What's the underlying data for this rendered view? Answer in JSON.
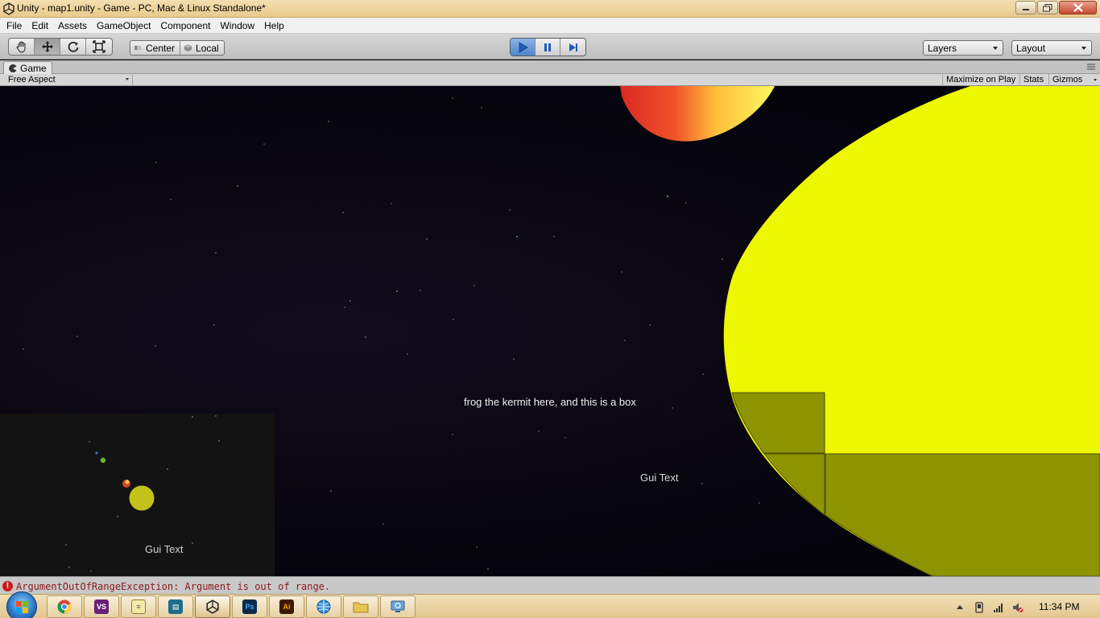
{
  "window": {
    "title": "Unity - map1.unity - Game - PC, Mac & Linux Standalone*"
  },
  "menu": [
    "File",
    "Edit",
    "Assets",
    "GameObject",
    "Component",
    "Window",
    "Help"
  ],
  "toolbar": {
    "pivot_center": "Center",
    "pivot_local": "Local",
    "layers": "Layers",
    "layout": "Layout"
  },
  "game": {
    "tab_label": "Game",
    "aspect": "Free Aspect",
    "maximize_on_play": "Maximize on Play",
    "stats": "Stats",
    "gizmos": "Gizmos",
    "gui_text_center": "frog the kermit here, and this is a box",
    "gui_text_right": "Gui Text",
    "gui_text_minimap": "Gui Text"
  },
  "status": {
    "message": "ArgumentOutOfRangeException: Argument is out of range."
  },
  "taskbar": {
    "apps": [
      "chrome",
      "visual-studio",
      "notepad",
      "sql-tool",
      "unity",
      "photoshop",
      "illustrator",
      "network-tool",
      "file-explorer",
      "remote-desktop"
    ],
    "clock": "11:34 PM"
  },
  "colors": {
    "planet_yellow": "#ecf700",
    "box_olive": "#8e9300",
    "sun_red": "#e0382c",
    "sun_yellow": "#fff25a",
    "play_active": "#4f84c9",
    "error_red": "#c81c1c"
  }
}
